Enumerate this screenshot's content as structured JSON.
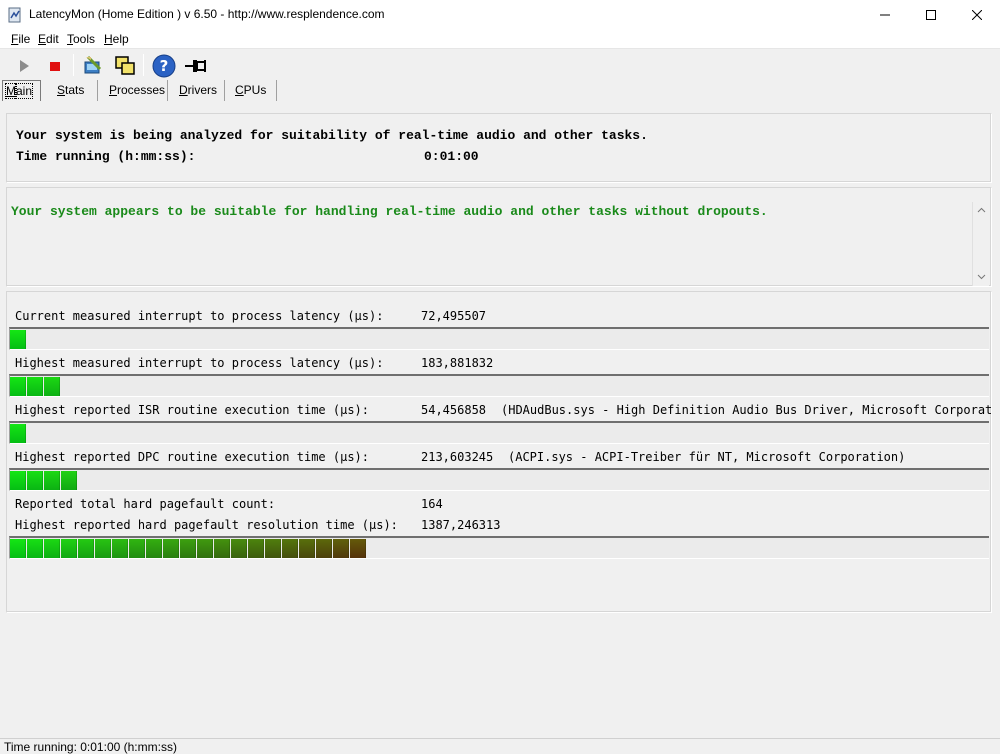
{
  "window": {
    "title": "LatencyMon  (Home Edition )  v 6.50 - http://www.resplendence.com"
  },
  "menu": [
    {
      "underline": "F",
      "rest": "ile"
    },
    {
      "underline": "E",
      "rest": "dit"
    },
    {
      "underline": "T",
      "rest": "ools"
    },
    {
      "underline": "H",
      "rest": "elp"
    }
  ],
  "toolbar": {
    "icons": [
      "play-icon",
      "stop-icon",
      "report-icon",
      "windows-icon",
      "help-icon",
      "pin-icon"
    ]
  },
  "tabs": [
    {
      "underline": "M",
      "rest": "ain",
      "active": true
    },
    {
      "underline": "S",
      "rest": "tats"
    },
    {
      "underline": "P",
      "rest": "rocesses"
    },
    {
      "underline": "D",
      "rest": "rivers"
    },
    {
      "underline": "C",
      "rest": "PUs"
    }
  ],
  "analysis": {
    "line1": "Your system is being analyzed for suitability of real-time audio and other tasks.",
    "time_label": "Time running (h:mm:ss):",
    "time_value": "0:01:00"
  },
  "verdict": {
    "text": "Your system appears to be suitable for handling real-time audio and other tasks without dropouts.",
    "color": "#1a8a1a"
  },
  "metrics": {
    "current_latency": {
      "label": "Current measured interrupt to process latency (µs):",
      "value": "72,495507",
      "bar_segments": 1
    },
    "highest_latency": {
      "label": "Highest measured interrupt to process latency (µs):",
      "value": "183,881832",
      "bar_segments": 3
    },
    "isr": {
      "label": "Highest reported ISR routine execution time (µs):",
      "value": "54,456858",
      "detail": "(HDAudBus.sys - High Definition Audio Bus Driver, Microsoft Corporation)",
      "bar_segments": 1
    },
    "dpc": {
      "label": "Highest reported DPC routine execution time (µs):",
      "value": "213,603245",
      "detail": "(ACPI.sys - ACPI-Treiber für NT, Microsoft Corporation)",
      "bar_segments": 4
    },
    "pagefault_count": {
      "label": "Reported total hard pagefault count:",
      "value": "164"
    },
    "pagefault_time": {
      "label": "Highest reported hard pagefault resolution time (µs):",
      "value": "1387,246313",
      "bar_segments": 21
    }
  },
  "statusbar": {
    "text": "Time running: 0:01:00  (h:mm:ss)"
  }
}
